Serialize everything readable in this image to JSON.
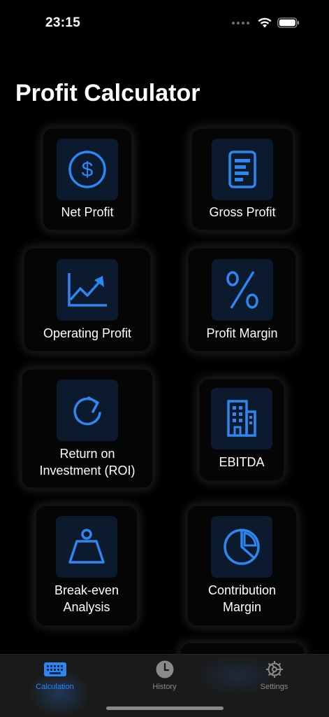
{
  "status": {
    "time": "23:15"
  },
  "title": "Profit Calculator",
  "cards": [
    {
      "label": "Net Profit",
      "icon": "dollar-circle-icon"
    },
    {
      "label": "Gross Profit",
      "icon": "document-bars-icon"
    },
    {
      "label": "Operating Profit",
      "icon": "trend-chart-icon"
    },
    {
      "label": "Profit Margin",
      "icon": "percent-icon"
    },
    {
      "label": "Return on\nInvestment (ROI)",
      "icon": "refresh-arrow-icon"
    },
    {
      "label": "EBITDA",
      "icon": "building-icon"
    },
    {
      "label": "Break-even\nAnalysis",
      "icon": "weight-icon"
    },
    {
      "label": "Contribution\nMargin",
      "icon": "pie-chart-icon"
    }
  ],
  "tabs": [
    {
      "label": "Calculation",
      "icon": "keyboard-icon",
      "active": true
    },
    {
      "label": "History",
      "icon": "clock-icon",
      "active": false
    },
    {
      "label": "Settings",
      "icon": "gear-icon",
      "active": false
    }
  ],
  "colors": {
    "accent": "#2f86f0",
    "icon_bg": "#0c1a2d",
    "tab_bar": "#1a1a1a"
  }
}
